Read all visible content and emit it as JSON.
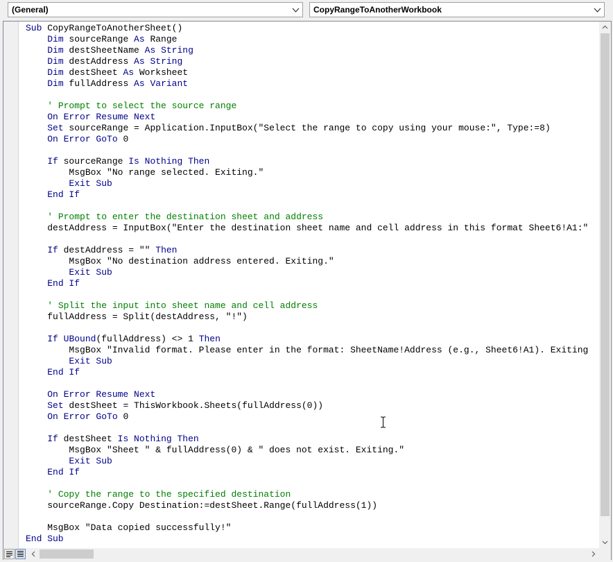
{
  "dropdowns": {
    "object": "(General)",
    "procedure": "CopyRangeToAnotherWorkbook"
  },
  "code_lines": [
    [
      [
        "k",
        "Sub"
      ],
      [
        "t",
        " CopyRangeToAnotherSheet()"
      ]
    ],
    [
      [
        "t",
        "    "
      ],
      [
        "k",
        "Dim"
      ],
      [
        "t",
        " sourceRange "
      ],
      [
        "k",
        "As"
      ],
      [
        "t",
        " Range"
      ]
    ],
    [
      [
        "t",
        "    "
      ],
      [
        "k",
        "Dim"
      ],
      [
        "t",
        " destSheetName "
      ],
      [
        "k",
        "As"
      ],
      [
        "t",
        " "
      ],
      [
        "k",
        "String"
      ]
    ],
    [
      [
        "t",
        "    "
      ],
      [
        "k",
        "Dim"
      ],
      [
        "t",
        " destAddress "
      ],
      [
        "k",
        "As"
      ],
      [
        "t",
        " "
      ],
      [
        "k",
        "String"
      ]
    ],
    [
      [
        "t",
        "    "
      ],
      [
        "k",
        "Dim"
      ],
      [
        "t",
        " destSheet "
      ],
      [
        "k",
        "As"
      ],
      [
        "t",
        " Worksheet"
      ]
    ],
    [
      [
        "t",
        "    "
      ],
      [
        "k",
        "Dim"
      ],
      [
        "t",
        " fullAddress "
      ],
      [
        "k",
        "As"
      ],
      [
        "t",
        " "
      ],
      [
        "k",
        "Variant"
      ]
    ],
    [],
    [
      [
        "t",
        "    "
      ],
      [
        "c",
        "' Prompt to select the source range"
      ]
    ],
    [
      [
        "t",
        "    "
      ],
      [
        "k",
        "On Error Resume Next"
      ]
    ],
    [
      [
        "t",
        "    "
      ],
      [
        "k",
        "Set"
      ],
      [
        "t",
        " sourceRange = Application.InputBox(\"Select the range to copy using your mouse:\", Type:=8)"
      ]
    ],
    [
      [
        "t",
        "    "
      ],
      [
        "k",
        "On Error GoTo"
      ],
      [
        "t",
        " 0"
      ]
    ],
    [],
    [
      [
        "t",
        "    "
      ],
      [
        "k",
        "If"
      ],
      [
        "t",
        " sourceRange "
      ],
      [
        "k",
        "Is Nothing Then"
      ]
    ],
    [
      [
        "t",
        "        MsgBox \"No range selected. Exiting.\""
      ]
    ],
    [
      [
        "t",
        "        "
      ],
      [
        "k",
        "Exit Sub"
      ]
    ],
    [
      [
        "t",
        "    "
      ],
      [
        "k",
        "End If"
      ]
    ],
    [],
    [
      [
        "t",
        "    "
      ],
      [
        "c",
        "' Prompt to enter the destination sheet and address"
      ]
    ],
    [
      [
        "t",
        "    destAddress = InputBox(\"Enter the destination sheet name and cell address in this format Sheet6!A1:\""
      ]
    ],
    [],
    [
      [
        "t",
        "    "
      ],
      [
        "k",
        "If"
      ],
      [
        "t",
        " destAddress = \"\" "
      ],
      [
        "k",
        "Then"
      ]
    ],
    [
      [
        "t",
        "        MsgBox \"No destination address entered. Exiting.\""
      ]
    ],
    [
      [
        "t",
        "        "
      ],
      [
        "k",
        "Exit Sub"
      ]
    ],
    [
      [
        "t",
        "    "
      ],
      [
        "k",
        "End If"
      ]
    ],
    [],
    [
      [
        "t",
        "    "
      ],
      [
        "c",
        "' Split the input into sheet name and cell address"
      ]
    ],
    [
      [
        "t",
        "    fullAddress = Split(destAddress, \"!\")"
      ]
    ],
    [],
    [
      [
        "t",
        "    "
      ],
      [
        "k",
        "If"
      ],
      [
        "t",
        " "
      ],
      [
        "k",
        "UBound"
      ],
      [
        "t",
        "(fullAddress) <> 1 "
      ],
      [
        "k",
        "Then"
      ]
    ],
    [
      [
        "t",
        "        MsgBox \"Invalid format. Please enter in the format: SheetName!Address (e.g., Sheet6!A1). Exiting"
      ]
    ],
    [
      [
        "t",
        "        "
      ],
      [
        "k",
        "Exit Sub"
      ]
    ],
    [
      [
        "t",
        "    "
      ],
      [
        "k",
        "End If"
      ]
    ],
    [],
    [
      [
        "t",
        "    "
      ],
      [
        "k",
        "On Error Resume Next"
      ]
    ],
    [
      [
        "t",
        "    "
      ],
      [
        "k",
        "Set"
      ],
      [
        "t",
        " destSheet = ThisWorkbook.Sheets(fullAddress(0))"
      ]
    ],
    [
      [
        "t",
        "    "
      ],
      [
        "k",
        "On Error GoTo"
      ],
      [
        "t",
        " 0"
      ]
    ],
    [],
    [
      [
        "t",
        "    "
      ],
      [
        "k",
        "If"
      ],
      [
        "t",
        " destSheet "
      ],
      [
        "k",
        "Is Nothing Then"
      ]
    ],
    [
      [
        "t",
        "        MsgBox \"Sheet \" & fullAddress(0) & \" does not exist. Exiting.\""
      ]
    ],
    [
      [
        "t",
        "        "
      ],
      [
        "k",
        "Exit Sub"
      ]
    ],
    [
      [
        "t",
        "    "
      ],
      [
        "k",
        "End If"
      ]
    ],
    [],
    [
      [
        "t",
        "    "
      ],
      [
        "c",
        "' Copy the range to the specified destination"
      ]
    ],
    [
      [
        "t",
        "    sourceRange.Copy Destination:=destSheet.Range(fullAddress(1))"
      ]
    ],
    [],
    [
      [
        "t",
        "    MsgBox \"Data copied successfully!\""
      ]
    ],
    [
      [
        "k",
        "End Sub"
      ]
    ]
  ],
  "colors": {
    "keyword": "#00008b",
    "comment": "#008000",
    "text": "#000000"
  },
  "icons": {
    "dropdown_arrow": "chevron-down-icon",
    "procedure_view": "procedure-view-icon",
    "module_view": "full-module-view-icon"
  }
}
